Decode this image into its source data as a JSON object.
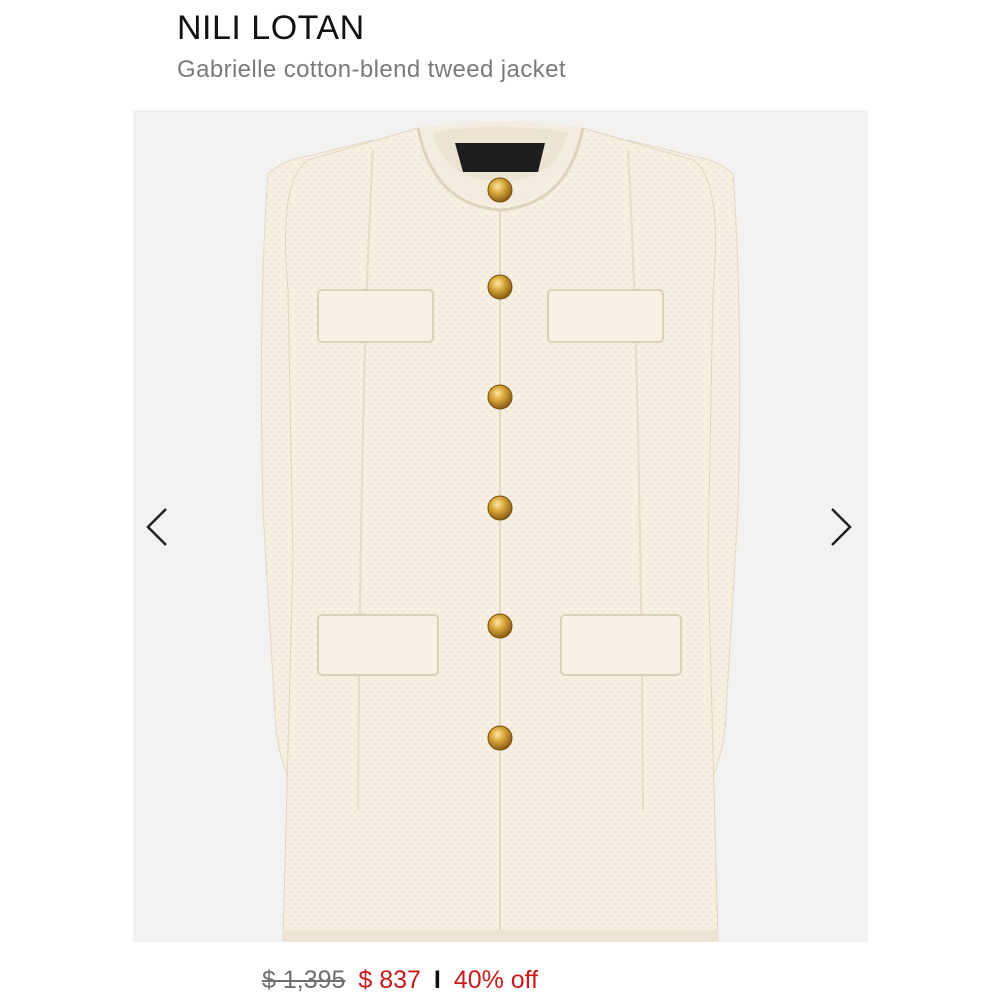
{
  "product": {
    "brand": "NILI LOTAN",
    "name": "Gabrielle cotton-blend tweed jacket",
    "image_alt": "Ivory tweed collarless jacket with gold buttons and flap pockets"
  },
  "gallery": {
    "prev_icon": "chevron-left-icon",
    "next_icon": "chevron-right-icon"
  },
  "pricing": {
    "original_price": "$ 1,395",
    "sale_price": "$ 837",
    "separator": "I",
    "discount": "40% off"
  },
  "colors": {
    "sale": "#cc1a1a",
    "jacket": "#f7f0e3",
    "buttons": "#c99a2e"
  }
}
